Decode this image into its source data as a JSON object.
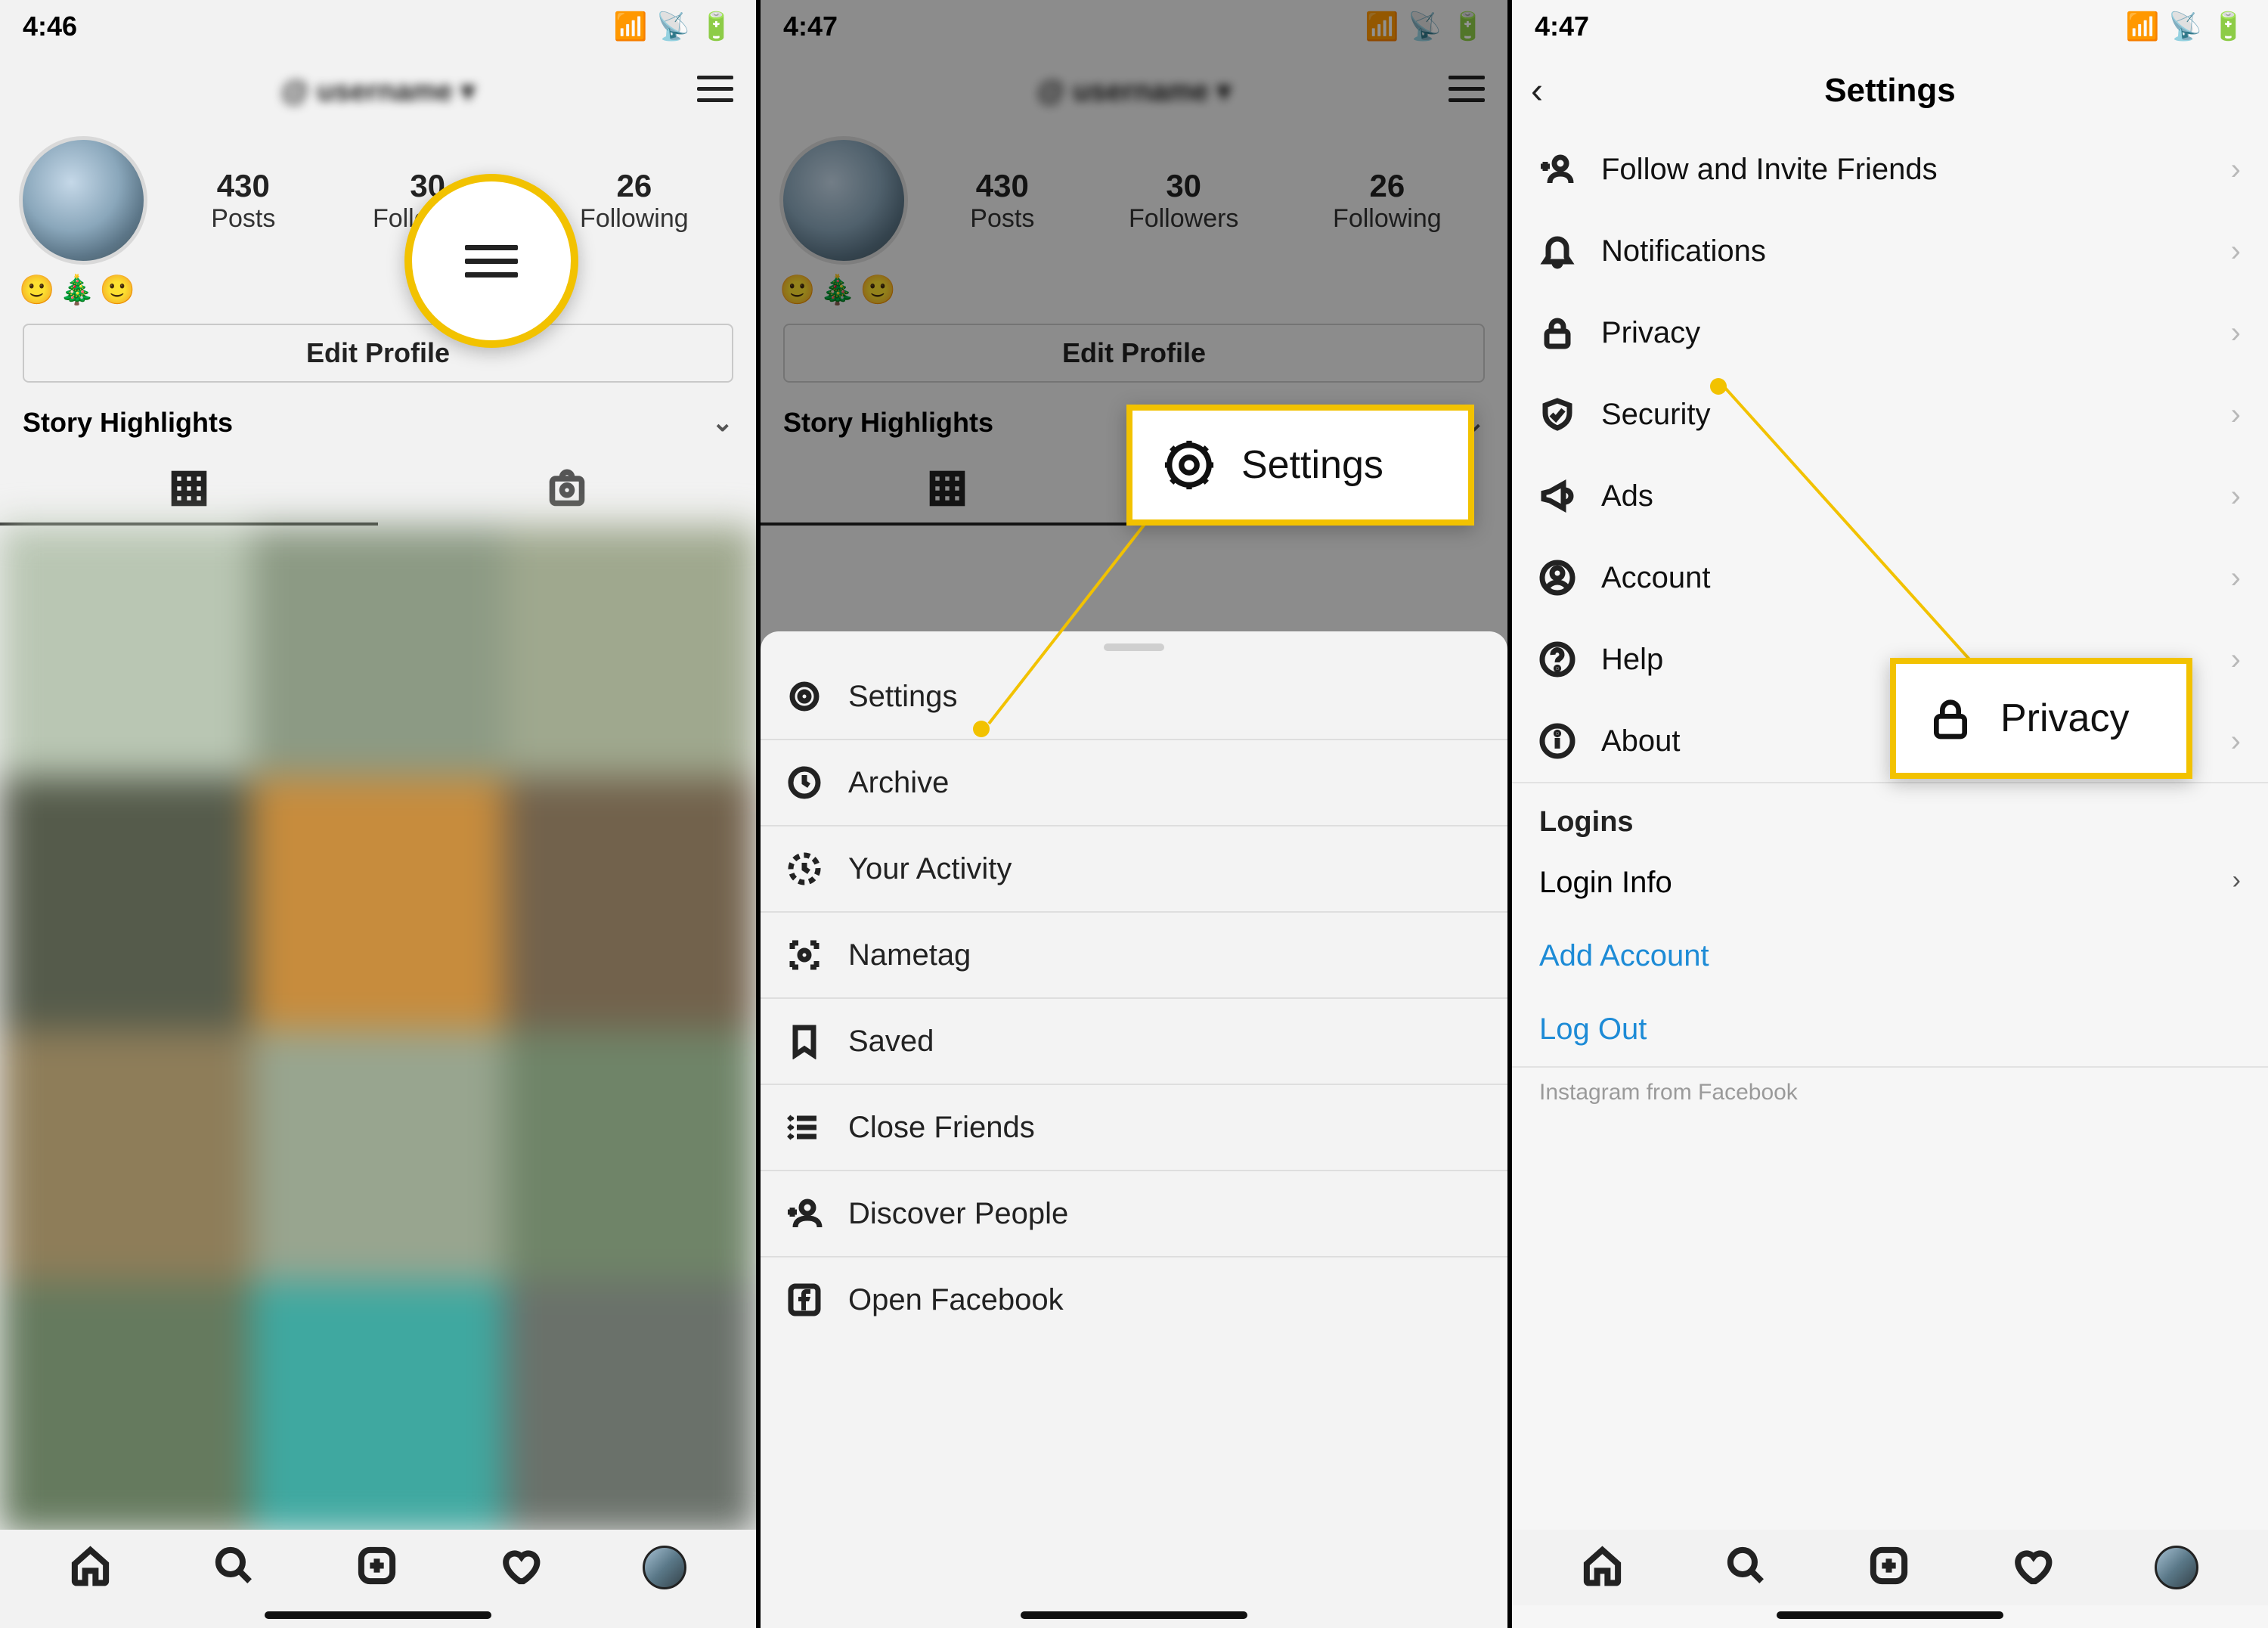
{
  "screens": [
    {
      "time": "4:46"
    },
    {
      "time": "4:47"
    },
    {
      "time": "4:47"
    }
  ],
  "profile": {
    "stats": {
      "posts_n": "430",
      "posts_l": "Posts",
      "followers_n": "30",
      "followers_l": "Followers",
      "following_n": "26",
      "following_l": "Following"
    },
    "bio": "🙂🎄🙂",
    "edit": "Edit Profile",
    "highlights": "Story Highlights"
  },
  "sheet": {
    "items": [
      {
        "icon": "gear",
        "label": "Settings"
      },
      {
        "icon": "archive",
        "label": "Archive"
      },
      {
        "icon": "activity",
        "label": "Your Activity"
      },
      {
        "icon": "nametag",
        "label": "Nametag"
      },
      {
        "icon": "saved",
        "label": "Saved"
      },
      {
        "icon": "close-friends",
        "label": "Close Friends"
      },
      {
        "icon": "discover",
        "label": "Discover People"
      },
      {
        "icon": "facebook",
        "label": "Open Facebook"
      }
    ]
  },
  "settings": {
    "title": "Settings",
    "items": [
      {
        "icon": "follow-invite",
        "label": "Follow and Invite Friends"
      },
      {
        "icon": "bell",
        "label": "Notifications"
      },
      {
        "icon": "lock",
        "label": "Privacy"
      },
      {
        "icon": "shield",
        "label": "Security"
      },
      {
        "icon": "ads",
        "label": "Ads"
      },
      {
        "icon": "account",
        "label": "Account"
      },
      {
        "icon": "help",
        "label": "Help"
      },
      {
        "icon": "info",
        "label": "About"
      }
    ],
    "section": "Logins",
    "login_info": "Login Info",
    "add_account": "Add Account",
    "log_out": "Log Out",
    "footer": "Instagram from Facebook"
  },
  "callouts": {
    "settings": "Settings",
    "privacy": "Privacy"
  }
}
